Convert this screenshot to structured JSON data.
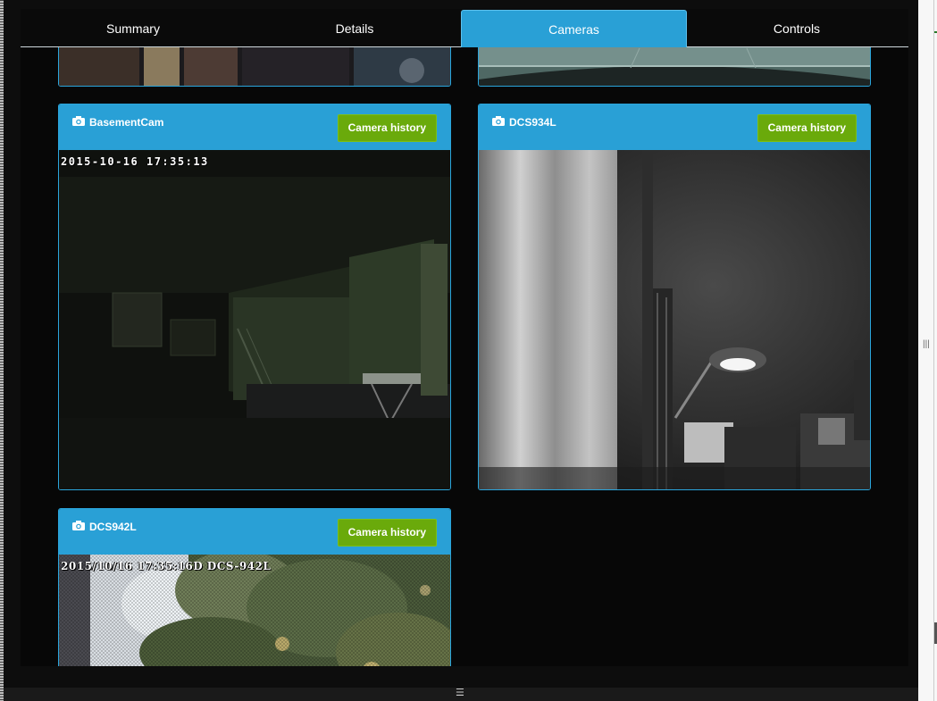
{
  "tabs": [
    {
      "label": "Summary"
    },
    {
      "label": "Details"
    },
    {
      "label": "Cameras"
    },
    {
      "label": "Controls"
    }
  ],
  "active_tab": "Cameras",
  "cameras": [
    {
      "name": "BasementCam",
      "history_label": "Camera history",
      "timestamp": "2015-10-16 17:35:13"
    },
    {
      "name": "DCS934L",
      "history_label": "Camera history",
      "timestamp": ""
    },
    {
      "name": "DCS942L",
      "history_label": "Camera history",
      "timestamp": "2015/10/16 17:35:16D DCS-942L"
    }
  ],
  "icons": {
    "camera": "camera-icon",
    "v_splitter": "vertical-splitter-grip",
    "h_splitter": "horizontal-splitter-grip"
  },
  "splitter": {
    "vertical_grip": "|||",
    "horizontal_grip": "☰"
  },
  "colors": {
    "header_blue": "#29a0d6",
    "button_green": "#6aaa0b",
    "panel_bg": "#070707"
  }
}
